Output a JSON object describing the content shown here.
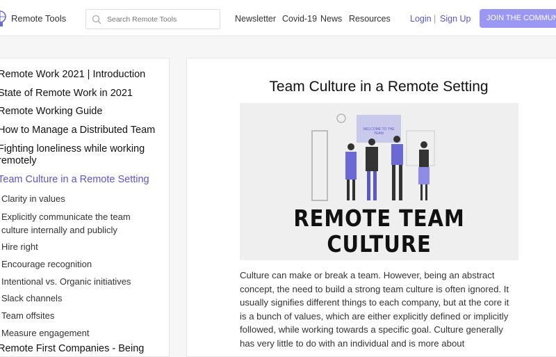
{
  "header": {
    "brand": "Remote Tools",
    "search_placeholder": "Search Remote Tools",
    "nav": [
      "Newsletter",
      "Covid-19",
      "News",
      "Resources"
    ],
    "login": "Login",
    "separator": "|",
    "signup": "Sign Up",
    "join": "JOIN THE COMMUNITY"
  },
  "sidebar": {
    "items": [
      {
        "label": "Remote Work 2021 | Introduction"
      },
      {
        "label": "State of Remote Work in 2021"
      },
      {
        "label": "Remote Working Guide"
      },
      {
        "label": "How to Manage a Distributed Team"
      },
      {
        "label": "Fighting loneliness while working"
      },
      {
        "label": "remotely"
      },
      {
        "label": "Team Culture in a Remote Setting"
      },
      {
        "label": "Clarity in values"
      },
      {
        "label": "Explicitly communicate the team"
      },
      {
        "label": "culture internally and publicly"
      },
      {
        "label": "Hire right"
      },
      {
        "label": "Encourage recognition"
      },
      {
        "label": "Intentional vs. Organic initiatives"
      },
      {
        "label": "Slack channels"
      },
      {
        "label": "Team offsites"
      },
      {
        "label": "Measure engagement"
      },
      {
        "label": "Remote First Companies - Being"
      }
    ]
  },
  "article": {
    "title": "Team Culture in a Remote Setting",
    "image_text": [
      "REMOTE TEAM",
      "CULTURE"
    ],
    "image_sign": "WELCOME TO THE TEAM",
    "body": "Culture can make or break a team. However, being an abstract concept, the need to build a strong team culture is often ignored. It usually signifies different things to each company, but at the core it is a bunch of values, which are either explicitly defined or implicitly followed, while working towards a specific goal. Culture generally has very little to do with an individual and is more about"
  }
}
